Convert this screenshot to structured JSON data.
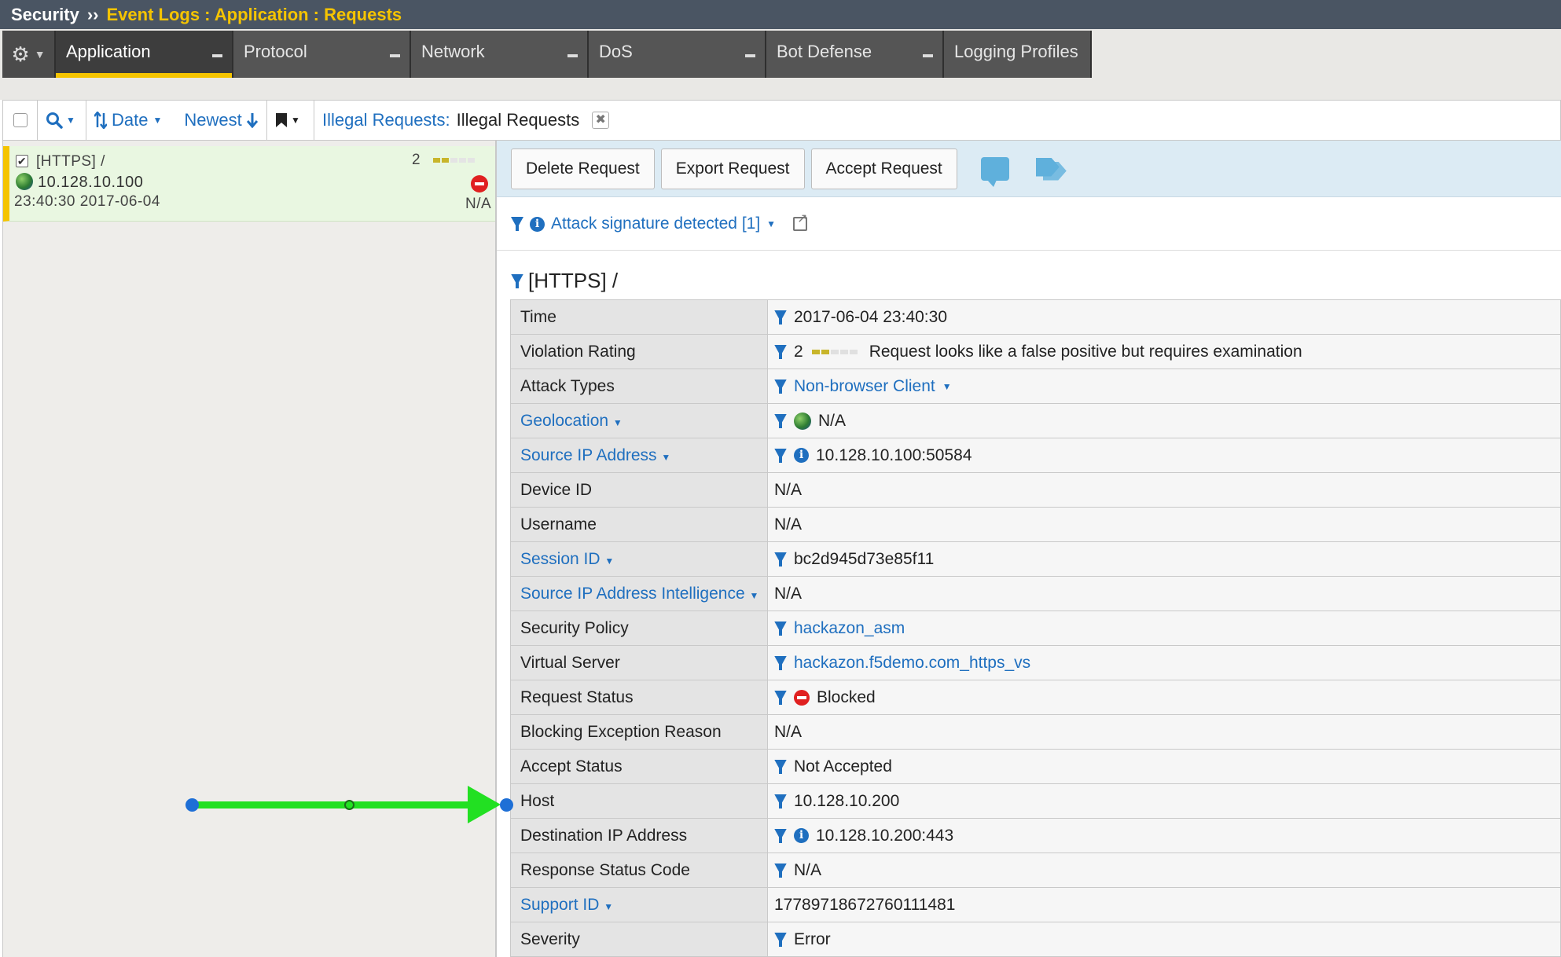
{
  "breadcrumb": {
    "root": "Security",
    "separator": "››",
    "path": "Event Logs : Application : Requests"
  },
  "nav": {
    "gear_icon": "gear-icon",
    "tabs": [
      {
        "label": "Application",
        "active": true
      },
      {
        "label": "Protocol"
      },
      {
        "label": "Network"
      },
      {
        "label": "DoS"
      },
      {
        "label": "Bot Defense"
      },
      {
        "label": "Logging Profiles"
      }
    ]
  },
  "toolbar": {
    "sort_field": "Date",
    "sort_order": "Newest",
    "filter_label": "Illegal Requests:",
    "filter_value": "Illegal Requests"
  },
  "list": {
    "items": [
      {
        "url": "[HTTPS] /",
        "ip": "10.128.10.100",
        "time": "23:40:30 2017-06-04",
        "rating": "2",
        "status": "N/A"
      }
    ]
  },
  "actions": {
    "delete": "Delete Request",
    "export": "Export Request",
    "accept": "Accept Request"
  },
  "signature": {
    "text": "Attack signature detected [1]"
  },
  "detail": {
    "title": "[HTTPS] /",
    "rows": [
      {
        "key": "Time",
        "value": "2017-06-04 23:40:30"
      },
      {
        "key": "Violation Rating",
        "value": "2",
        "extra": "Request looks like a false positive but requires examination"
      },
      {
        "key": "Attack Types",
        "value": "Non-browser Client"
      },
      {
        "key": "Geolocation",
        "value": "N/A"
      },
      {
        "key": "Source IP Address",
        "value": "10.128.10.100:50584"
      },
      {
        "key": "Device ID",
        "value": "N/A"
      },
      {
        "key": "Username",
        "value": "N/A"
      },
      {
        "key": "Session ID",
        "value": "bc2d945d73e85f11"
      },
      {
        "key": "Source IP Address Intelligence",
        "value": "N/A"
      },
      {
        "key": "Security Policy",
        "value": "hackazon_asm"
      },
      {
        "key": "Virtual Server",
        "value": "hackazon.f5demo.com_https_vs"
      },
      {
        "key": "Request Status",
        "value": "Blocked"
      },
      {
        "key": "Blocking Exception Reason",
        "value": "N/A"
      },
      {
        "key": "Accept Status",
        "value": "Not Accepted"
      },
      {
        "key": "Host",
        "value": "10.128.10.200"
      },
      {
        "key": "Destination IP Address",
        "value": "10.128.10.200:443"
      },
      {
        "key": "Response Status Code",
        "value": "N/A"
      },
      {
        "key": "Support ID",
        "value": "17789718672760111481"
      },
      {
        "key": "Severity",
        "value": "Error"
      }
    ]
  },
  "colors": {
    "accent": "#f5c400",
    "link": "#1f6fbf",
    "annotation_arrow": "#22e022"
  }
}
